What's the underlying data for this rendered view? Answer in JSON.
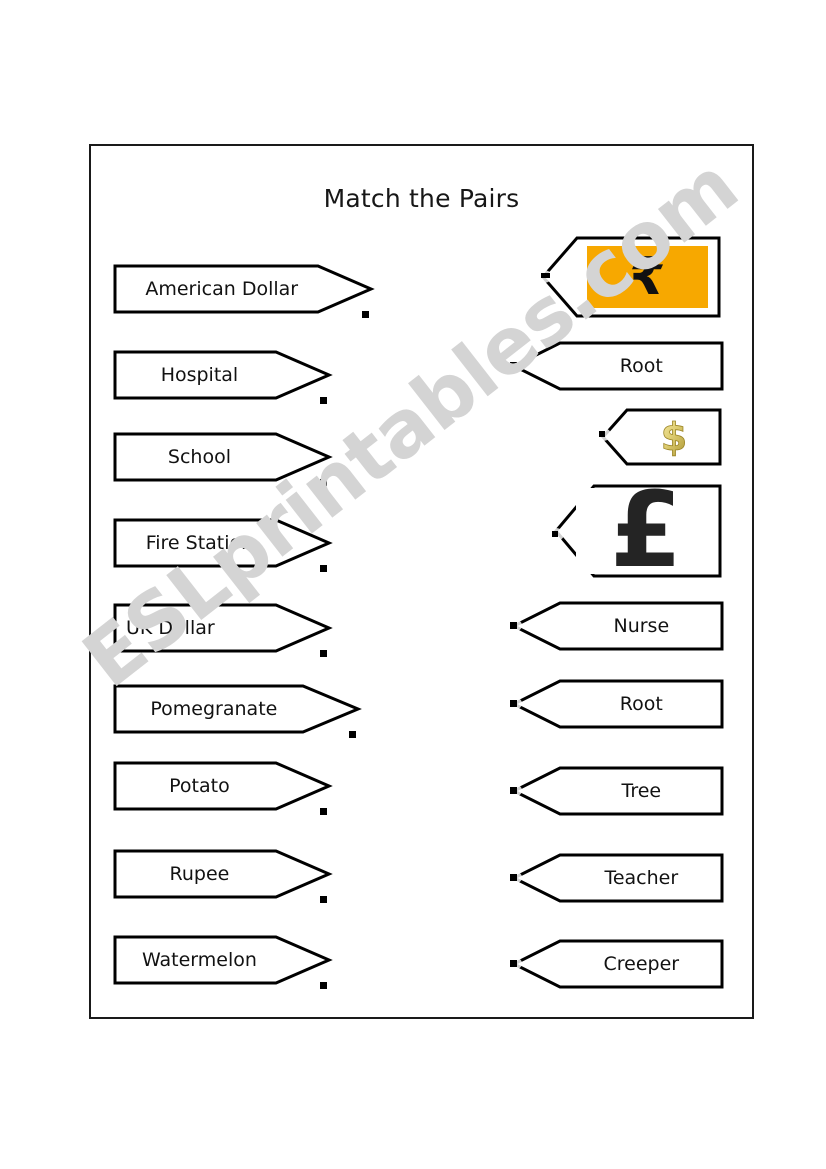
{
  "worksheet": {
    "title": "Match the Pairs",
    "watermark_text": "ESLprintables.com",
    "accent_color": "#f7a800",
    "border_color": "#1a1a1a",
    "text_color": "#121212"
  },
  "left_column": [
    {
      "label": "American Dollar"
    },
    {
      "label": "Hospital"
    },
    {
      "label": "School"
    },
    {
      "label": "Fire Station"
    },
    {
      "label": "UK Dollar"
    },
    {
      "label": "Pomegranate"
    },
    {
      "label": "Potato"
    },
    {
      "label": "Rupee"
    },
    {
      "label": "Watermelon"
    }
  ],
  "right_column": [
    {
      "label": "",
      "media": "rupee-symbol-image",
      "glyph": "₹"
    },
    {
      "label": "Root",
      "media": "",
      "glyph": ""
    },
    {
      "label": "",
      "media": "dollar-symbol-image",
      "glyph": "$"
    },
    {
      "label": "",
      "media": "pound-symbol-image",
      "glyph": "£"
    },
    {
      "label": "Nurse",
      "media": "",
      "glyph": ""
    },
    {
      "label": "Root",
      "media": "",
      "glyph": ""
    },
    {
      "label": "Tree",
      "media": "",
      "glyph": ""
    },
    {
      "label": "Teacher",
      "media": "",
      "glyph": ""
    },
    {
      "label": "Creeper",
      "media": "",
      "glyph": ""
    }
  ]
}
